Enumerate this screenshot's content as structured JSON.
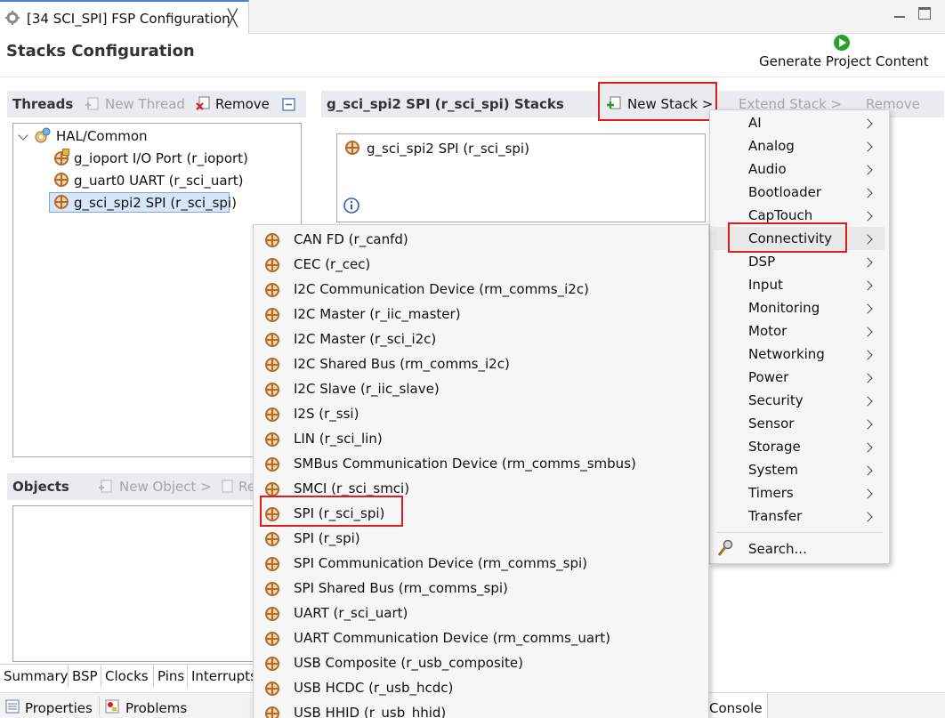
{
  "window": {
    "tab_title": "[34 SCI_SPI] FSP Configuration",
    "close_glyph": "╳"
  },
  "header": {
    "title": "Stacks Configuration",
    "generate_label": "Generate Project Content"
  },
  "threads": {
    "title": "Threads",
    "new_thread": "New Thread",
    "remove": "Remove",
    "tree": {
      "root": "HAL/Common",
      "items": [
        "g_ioport I/O Port (r_ioport)",
        "g_uart0 UART (r_sci_uart)",
        "g_sci_spi2 SPI (r_sci_spi)"
      ],
      "selected_index": 2
    }
  },
  "objects": {
    "title": "Objects",
    "new_object": "New Object >",
    "remove_partial": "Re"
  },
  "stacks": {
    "title": "g_sci_spi2 SPI (r_sci_spi) Stacks",
    "new_stack": "New Stack >",
    "extend_stack": "Extend Stack >",
    "remove": "Remove",
    "stack_item": "g_sci_spi2 SPI (r_sci_spi)"
  },
  "category_menu": {
    "items": [
      "AI",
      "Analog",
      "Audio",
      "Bootloader",
      "CapTouch",
      "Connectivity",
      "DSP",
      "Input",
      "Monitoring",
      "Motor",
      "Networking",
      "Power",
      "Security",
      "Sensor",
      "Storage",
      "System",
      "Timers",
      "Transfer"
    ],
    "highlighted": "Connectivity",
    "search": "Search..."
  },
  "connectivity_menu": {
    "items": [
      "CAN FD (r_canfd)",
      "CEC (r_cec)",
      "I2C Communication Device (rm_comms_i2c)",
      "I2C Master (r_iic_master)",
      "I2C Master (r_sci_i2c)",
      "I2C Shared Bus (rm_comms_i2c)",
      "I2C Slave (r_iic_slave)",
      "I2S (r_ssi)",
      "LIN (r_sci_lin)",
      "SMBus Communication Device (rm_comms_smbus)",
      "SMCI (r_sci_smci)",
      "SPI (r_sci_spi)",
      "SPI (r_spi)",
      "SPI Communication Device (rm_comms_spi)",
      "SPI Shared Bus (rm_comms_spi)",
      "UART (r_sci_uart)",
      "UART Communication Device (rm_comms_uart)",
      "USB Composite (r_usb_composite)",
      "USB HCDC (r_usb_hcdc)",
      "USB HHID (r_usb_hhid)"
    ],
    "highlighted": "SPI (r_sci_spi)"
  },
  "bottom_tabs": [
    "Summary",
    "BSP",
    "Clocks",
    "Pins",
    "Interrupts"
  ],
  "views": {
    "properties": "Properties",
    "problems": "Problems",
    "console": "Console"
  },
  "colors": {
    "highlight_box": "#e01b1b",
    "selection": "#d6e6fb",
    "panel_header": "#e9ebef"
  }
}
